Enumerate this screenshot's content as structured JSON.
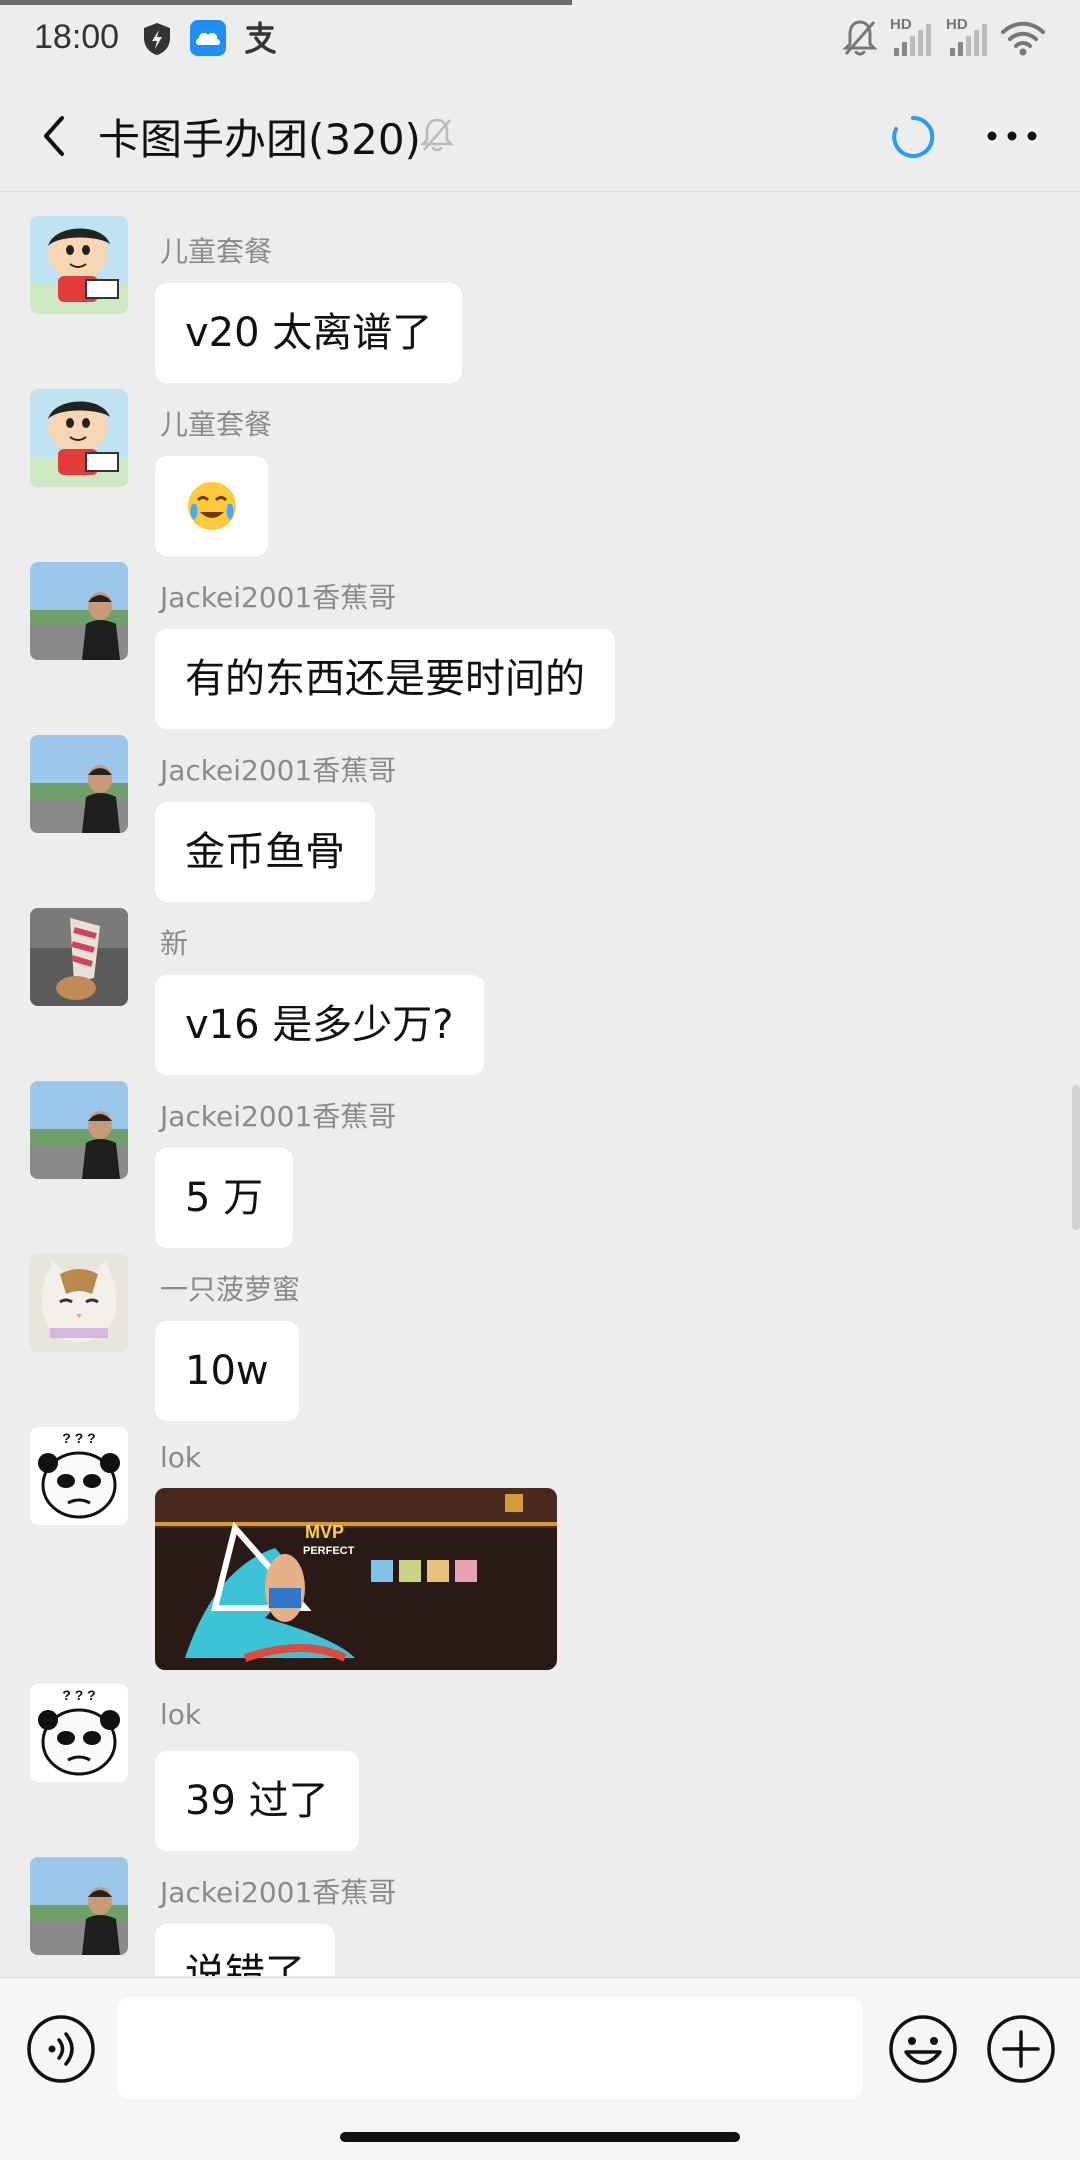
{
  "status_bar": {
    "time": "18:00",
    "hd1": "HD",
    "hd2": "HD"
  },
  "header": {
    "title": "卡图手办团(320)"
  },
  "messages": [
    {
      "sender": "儿童套餐",
      "text": "v20 太离谱了",
      "avatar": "cartoon-boy"
    },
    {
      "sender": "儿童套餐",
      "text": "😭",
      "avatar": "cartoon-boy"
    },
    {
      "sender": "Jackei2001香蕉哥",
      "text": "有的东西还是要时间的",
      "avatar": "man-outdoor"
    },
    {
      "sender": "Jackei2001香蕉哥",
      "text": "金币鱼骨",
      "avatar": "man-outdoor"
    },
    {
      "sender": "新",
      "text": "v16 是多少万?",
      "avatar": "figure-photo"
    },
    {
      "sender": "Jackei2001香蕉哥",
      "text": "5 万",
      "avatar": "man-outdoor"
    },
    {
      "sender": "一只菠萝蜜",
      "text": "10w",
      "avatar": "cat"
    },
    {
      "sender": "lok",
      "image": true,
      "avatar": "panda-meme",
      "image_text_1": "MVP",
      "image_text_2": "PERFECT"
    },
    {
      "sender": "lok",
      "text": "39 过了",
      "avatar": "panda-meme"
    },
    {
      "sender": "Jackei2001香蕉哥",
      "text": "说错了",
      "avatar": "man-outdoor"
    }
  ],
  "avatar_text": {
    "panda": "? ? ?"
  },
  "colors": {
    "background": "#ededed",
    "bubble": "#ffffff",
    "accent": "#2c9cf0"
  }
}
